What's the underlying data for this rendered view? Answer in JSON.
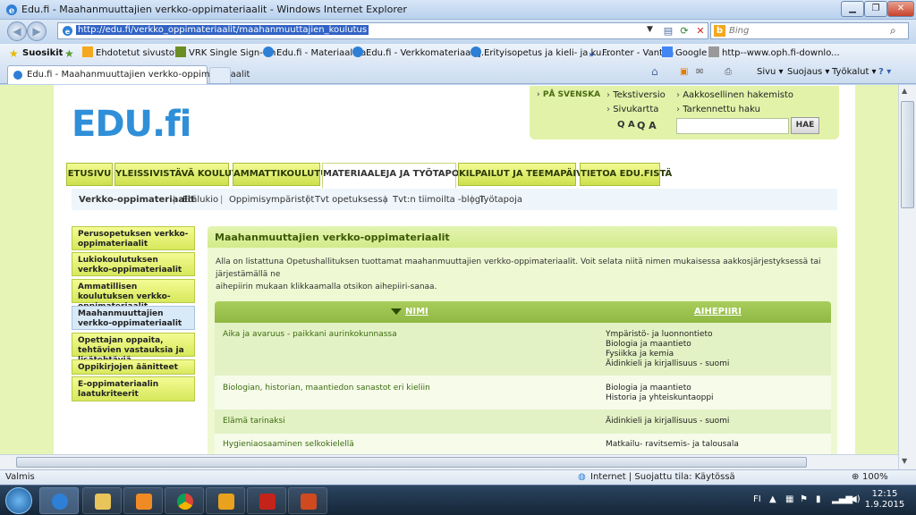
{
  "window": {
    "title": "Edu.fi - Maahanmuuttajien verkko-oppimateriaalit - Windows Internet Explorer",
    "min": "▁",
    "max": "❐",
    "close": "✕"
  },
  "address_bar": {
    "url": "http://edu.fi/verkko_oppimateriaalit/maahanmuuttajien_koulutus",
    "back": "◀",
    "forward": "▶"
  },
  "search": {
    "placeholder": "Bing",
    "logo": "b"
  },
  "favorites_bar": [
    "Suosikit",
    "Ehdotetut sivustot ▾",
    "VRK Single Sign-On",
    "Edu.fi - Materiaaleja",
    "Edu.fi - Verkkomateriaalej...",
    "Erityisopetus ja kieli- ja ku...",
    "Fronter - Vantaa",
    "Google",
    "http--www.oph.fi-downlo..."
  ],
  "tab": {
    "label": "Edu.fi - Maahanmuuttajien verkko-oppimateriaalit"
  },
  "command_bar": {
    "page": "Sivu ▾",
    "safety": "Suojaus ▾",
    "tools": "Työkalut ▾",
    "help": "? ▾"
  },
  "site": {
    "logo": "EDU.fi",
    "tools": {
      "lang": "PÅ SVENSKA",
      "text_version": "Tekstiversio",
      "sitemap": "Sivukartta",
      "alphabetical": "Aakkosellinen hakemisto",
      "advanced": "Tarkennettu haku",
      "zoom_out": "Q A",
      "zoom_in": "Q A",
      "search_button": "HAE"
    },
    "main_nav": [
      "ETUSIVU",
      "YLEISSIVISTÄVÄ KOULUTUS",
      "AMMATTIKOULUTUS",
      "MATERIAALEJA JA TYÖTAPOJA",
      "KILPAILUT JA TEEMAPÄIVÄT",
      "TIETOA EDU.FISTÄ"
    ],
    "sub_nav": [
      "Verkko-oppimateriaalit",
      "Etälukio",
      "Oppimisympäristöt",
      "Tvt opetuksessa",
      "Tvt:n tiimoilta -blogi",
      "Työtapoja"
    ],
    "sub_nav_sep": "|",
    "sidebar": [
      "Perusopetuksen verkko-oppimateriaalit",
      "Lukiokoulutuksen verkko-oppimateriaalit",
      "Ammatillisen koulutuksen verkko-oppimateriaalit",
      "Maahanmuuttajien verkko-oppimateriaalit",
      "Opettajan oppaita, tehtävien vastauksia ja lisätehtäviä",
      "Oppikirjojen äänitteet",
      "E-oppimateriaalin laatukriteerit"
    ],
    "content": {
      "title": "Maahanmuuttajien verkko-oppimateriaalit",
      "intro_line1": "Alla on listattuna Opetushallituksen tuottamat maahanmuuttajien verkko-oppimateriaalit. Voit selata niitä nimen mukaisessa aakkosjärjestyksessä tai järjestämällä ne",
      "intro_line2": "aihepiirin mukaan klikkaamalla otsikon aihepiiri-sanaa.",
      "col_name": "NIMI",
      "col_topic": "AIHEPIIRI",
      "rows": [
        {
          "name": "Aika ja avaruus - paikkani aurinkokunnassa",
          "topics": [
            "Ympäristö- ja luonnontieto",
            "Biologia ja maantieto",
            "Fysiikka ja kemia",
            "Äidinkieli ja kirjallisuus - suomi"
          ]
        },
        {
          "name": "Biologian, historian, maantiedon sanastot eri kieliin",
          "topics": [
            "Biologia ja maantieto",
            "Historia ja yhteiskuntaoppi"
          ]
        },
        {
          "name": "Elämä tarinaksi",
          "topics": [
            "Äidinkieli ja kirjallisuus - suomi"
          ]
        },
        {
          "name": "Hygieniaosaaminen selkokielellä",
          "topics": [
            "Matkailu- ravitsemis- ja talousala"
          ]
        }
      ]
    }
  },
  "status_bar": {
    "left": "Valmis",
    "zone": "Internet | Suojattu tila: Käytössä",
    "zoom": "100%"
  },
  "taskbar": {
    "lang": "FI",
    "time": "12:15",
    "date": "1.9.2015"
  },
  "colors": {
    "logo": "#2f8fd8",
    "nav_green": "#cde04c",
    "table_header": "#8fb843"
  }
}
